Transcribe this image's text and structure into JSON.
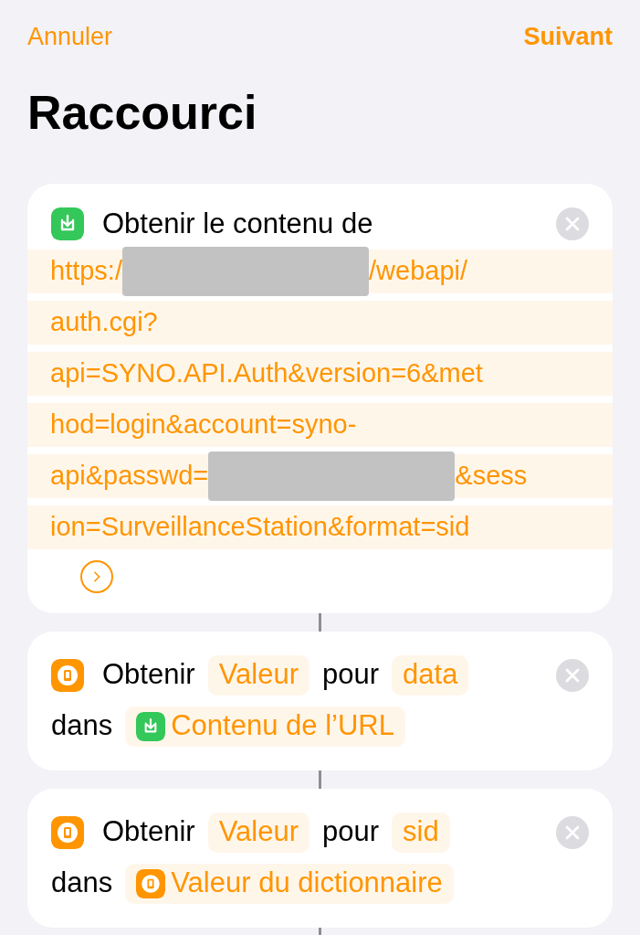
{
  "nav": {
    "cancel": "Annuler",
    "next": "Suivant"
  },
  "title": "Raccourci",
  "actions": [
    {
      "kind": "url",
      "title": "Obtenir le contenu de",
      "lines": [
        [
          {
            "kind": "text",
            "text": "https:/"
          },
          {
            "kind": "redacted"
          },
          {
            "kind": "text",
            "text": "/webapi/"
          }
        ],
        [
          {
            "kind": "text",
            "text": "auth.cgi?"
          }
        ],
        [
          {
            "kind": "text",
            "text": "api=SYNO.API.Auth&version=6&met"
          }
        ],
        [
          {
            "kind": "text",
            "text": "hod=login&account=syno-"
          }
        ],
        [
          {
            "kind": "text",
            "text": "api&passwd="
          },
          {
            "kind": "redacted"
          },
          {
            "kind": "text",
            "text": "&sess"
          }
        ],
        [
          {
            "kind": "text",
            "text": "ion=SurveillanceStation&format=sid"
          }
        ]
      ]
    },
    {
      "kind": "param",
      "lines": [
        [
          {
            "kind": "text",
            "text": "Obtenir"
          },
          {
            "kind": "token",
            "text": "Valeur"
          },
          {
            "kind": "text",
            "text": "pour"
          },
          {
            "kind": "token",
            "text": "data"
          }
        ],
        [
          {
            "kind": "text",
            "text": "dans"
          },
          {
            "kind": "url_variable",
            "text": "Contenu de l’URL"
          }
        ]
      ]
    },
    {
      "kind": "param",
      "lines": [
        [
          {
            "kind": "text",
            "text": "Obtenir"
          },
          {
            "kind": "token",
            "text": "Valeur"
          },
          {
            "kind": "text",
            "text": "pour"
          },
          {
            "kind": "token",
            "text": "sid"
          }
        ],
        [
          {
            "kind": "text",
            "text": "dans"
          },
          {
            "kind": "dict_variable",
            "text": "Valeur du dictionnaire"
          }
        ]
      ]
    }
  ]
}
